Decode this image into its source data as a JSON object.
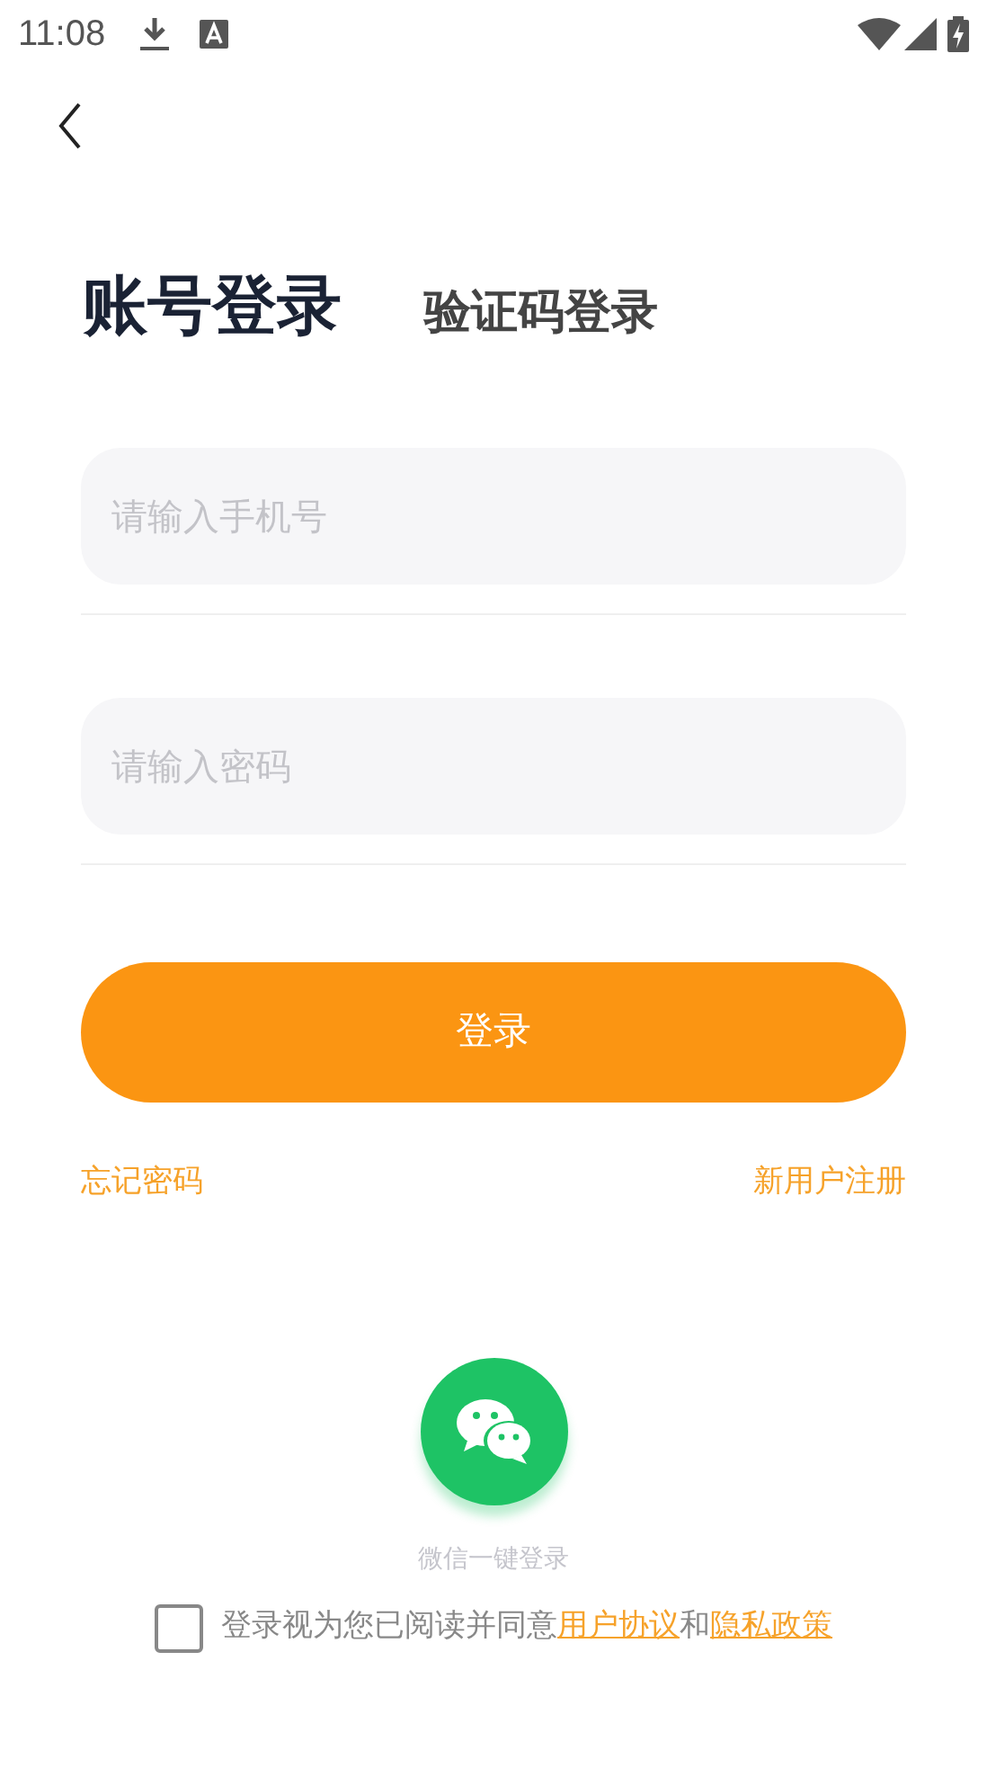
{
  "status_bar": {
    "time": "11:08"
  },
  "tabs": [
    {
      "label": "账号登录",
      "selected": true
    },
    {
      "label": "验证码登录",
      "selected": false
    }
  ],
  "fields": [
    {
      "placeholder": "请输入手机号"
    },
    {
      "placeholder": "请输入密码"
    }
  ],
  "login_button": "登录",
  "links": {
    "forgot": "忘记密码",
    "register": "新用户注册"
  },
  "wechat": {
    "label": "微信一键登录"
  },
  "agreement": {
    "checked": false,
    "parts": [
      {
        "kind": "text",
        "text": "登录视为您已阅读并同意"
      },
      {
        "kind": "link",
        "text": "用户协议"
      },
      {
        "kind": "text",
        "text": "和"
      },
      {
        "kind": "link",
        "text": "隐私政策"
      }
    ]
  }
}
